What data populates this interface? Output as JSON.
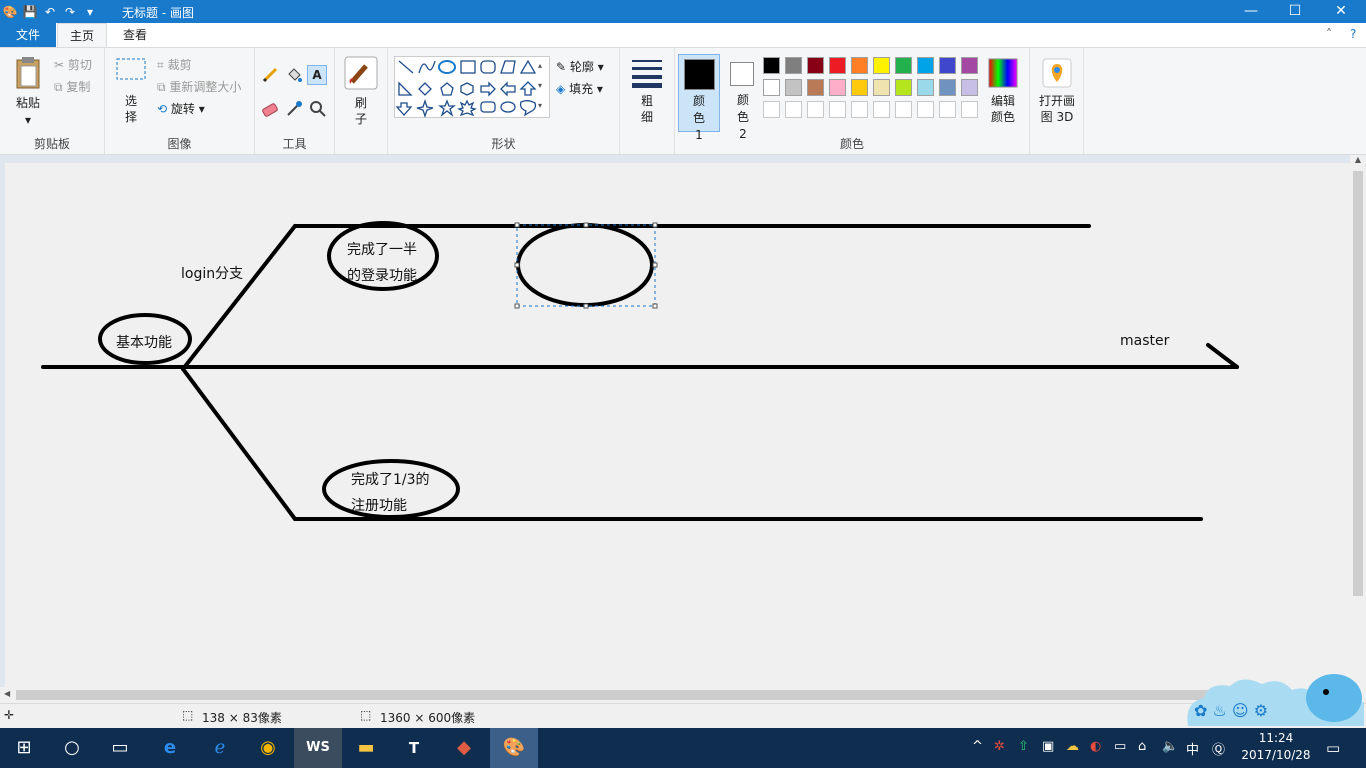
{
  "window": {
    "title": "无标题 - 画图",
    "controls": {
      "minimize": "—",
      "maximize": "☐",
      "close": "✕"
    }
  },
  "tabs": [
    {
      "label": "文件"
    },
    {
      "label": "主页"
    },
    {
      "label": "查看"
    }
  ],
  "ribbon": {
    "clipboard": {
      "paste": "粘贴",
      "cut": "剪切",
      "copy": "复制",
      "name": "剪贴板"
    },
    "image": {
      "select": "选择",
      "crop": "裁剪",
      "resize": "重新调整大小",
      "rotate": "旋转",
      "name": "图像"
    },
    "tools": {
      "name": "工具"
    },
    "brush": {
      "label": "刷子"
    },
    "shapes": {
      "outline": "轮廓",
      "fill": "填充",
      "name": "形状"
    },
    "size": {
      "label": "粗细"
    },
    "colors": {
      "color1": "颜色 1",
      "color2": "颜色 2",
      "edit": "编辑颜色",
      "name": "颜色",
      "color1_value": "#000000",
      "color2_value": "#ffffff",
      "palette_row1": [
        "#000000",
        "#7f7f7f",
        "#880015",
        "#ed1c24",
        "#ff7f27",
        "#fff200",
        "#22b14c",
        "#00a2e8",
        "#3f48cc",
        "#a349a4"
      ],
      "palette_row2": [
        "#ffffff",
        "#c3c3c3",
        "#b97a57",
        "#ffaec9",
        "#ffc90e",
        "#efe4b0",
        "#b5e61d",
        "#99d9ea",
        "#7092be",
        "#c8bfe7"
      ],
      "palette_row3": [
        "#ffffff",
        "#ffffff",
        "#ffffff",
        "#ffffff",
        "#ffffff",
        "#ffffff",
        "#ffffff",
        "#ffffff",
        "#ffffff",
        "#ffffff"
      ]
    },
    "paint3d": {
      "label": "打开画图 3D"
    }
  },
  "drawing": {
    "login_branch": "login分支",
    "base_feature": "基本功能",
    "login_progress_line1": "完成了一半",
    "login_progress_line2": "的登录功能",
    "register_progress_line1": "完成了1/3的",
    "register_progress_line2": "注册功能",
    "master": "master"
  },
  "status": {
    "selection_size": "138 × 83像素",
    "canvas_size": "1360 × 600像素"
  },
  "taskbar": {
    "time": "11:24",
    "date": "2017/10/28",
    "ime": "中"
  }
}
